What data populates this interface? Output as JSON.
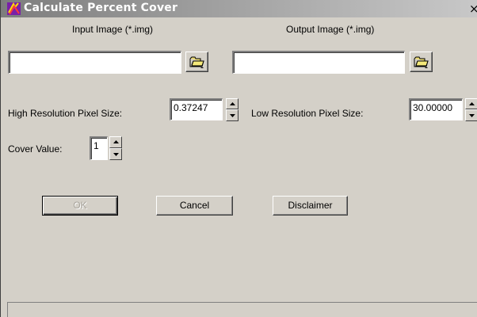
{
  "window": {
    "title": "Calculate Percent Cover",
    "close_glyph": "×"
  },
  "input_image": {
    "label": "Input Image (*.img)",
    "value": "",
    "browse_icon": "folder-open-icon"
  },
  "output_image": {
    "label": "Output Image (*.img)",
    "value": "",
    "browse_icon": "folder-open-icon"
  },
  "high_res": {
    "label": "High Resolution Pixel Size:",
    "value": "0.37247"
  },
  "low_res": {
    "label": "Low Resolution Pixel Size:",
    "value": "30.00000"
  },
  "cover": {
    "label": "Cover Value:",
    "value": "1"
  },
  "buttons": {
    "ok": "OK",
    "cancel": "Cancel",
    "disclaimer": "Disclaimer"
  },
  "colors": {
    "face": "#d4d0c8",
    "title_start": "#7d7d7d",
    "title_end": "#c8c8c8"
  }
}
